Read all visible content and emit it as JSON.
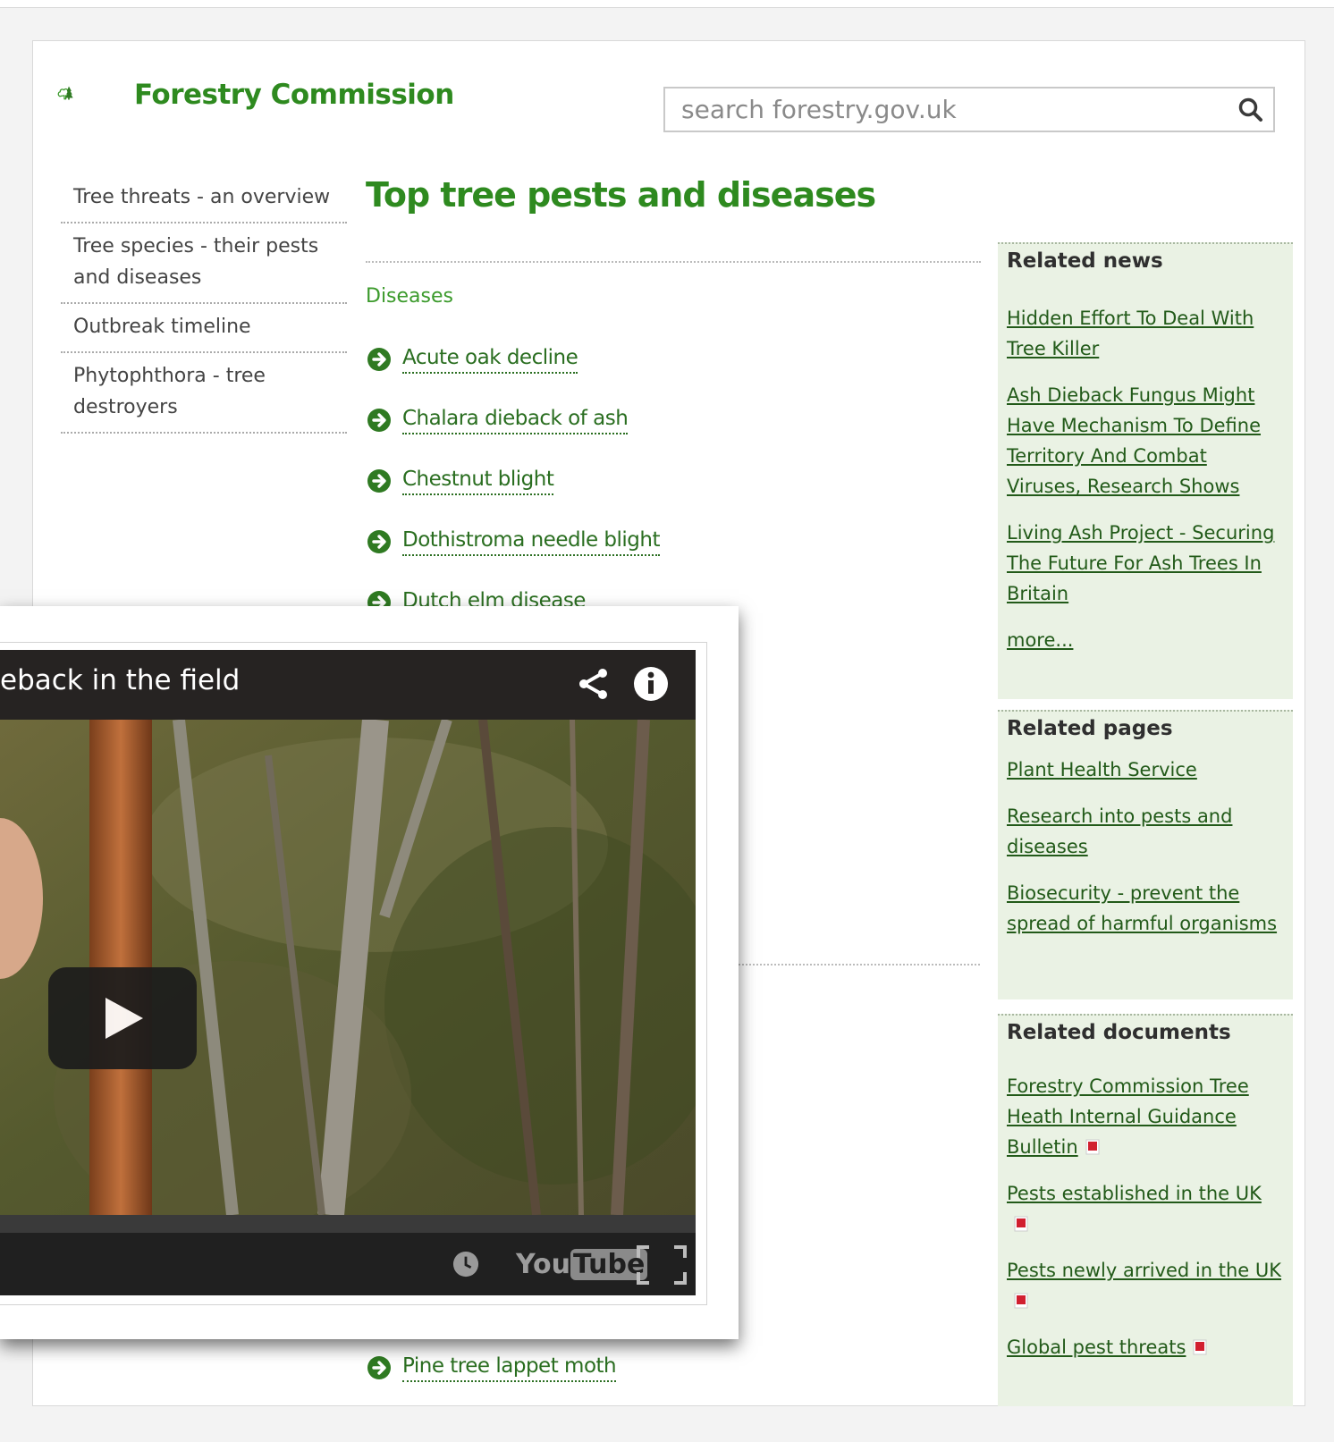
{
  "header": {
    "logo_text": "Forestry Commission",
    "search_placeholder": "search forestry.gov.uk"
  },
  "left_nav": [
    {
      "label": "Tree threats - an overview"
    },
    {
      "label": "Tree species - their pests and diseases"
    },
    {
      "label": "Outbreak timeline"
    },
    {
      "label": "Phytophthora - tree destroyers"
    }
  ],
  "main": {
    "title": "Top tree pests and diseases",
    "section_label": "Diseases",
    "items": [
      {
        "label": "Acute oak decline"
      },
      {
        "label": "Chalara dieback of ash"
      },
      {
        "label": "Chestnut blight"
      },
      {
        "label": "Dothistroma needle blight"
      },
      {
        "label": "Dutch elm disease"
      },
      {
        "label": "Pine tree lappet moth"
      }
    ]
  },
  "sidebar": {
    "news": {
      "heading": "Related news",
      "links": [
        "Hidden Effort To Deal With Tree Killer",
        "Ash Dieback Fungus Might Have Mechanism To Define Territory And Combat Viruses, Research Shows",
        "Living Ash Project - Securing The Future For Ash Trees In Britain",
        "more..."
      ]
    },
    "pages": {
      "heading": "Related pages",
      "links": [
        "Plant Health Service",
        "Research into pests and diseases",
        "Biosecurity - prevent the spread of harmful organisms"
      ]
    },
    "documents": {
      "heading": "Related documents",
      "links": [
        "Forestry Commission Tree Heath Internal Guidance Bulletin",
        "Pests established in the UK",
        "Pests newly arrived in the UK",
        "Global pest threats"
      ]
    }
  },
  "video": {
    "title": "eback in the field",
    "watermark": "You",
    "watermark_tube": "Tube"
  },
  "colors": {
    "brand_green": "#2e8a1f",
    "link_green": "#225a19",
    "sidebar_bg": "#eaf2e4"
  },
  "icons": {
    "search": "search-icon",
    "list_arrow": "circle-arrow-right-icon",
    "pdf": "pdf-icon",
    "share": "share-icon",
    "info": "info-icon",
    "clock": "clock-icon",
    "fullscreen": "fullscreen-icon",
    "play": "play-icon"
  }
}
